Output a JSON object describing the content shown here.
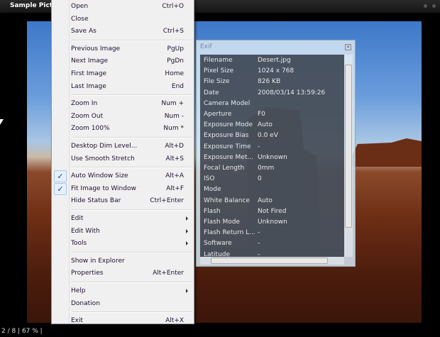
{
  "window": {
    "title": "Sample Pictu"
  },
  "status": {
    "text": "2 / 8 | 67 % |"
  },
  "menu": {
    "items": [
      {
        "label": "Open",
        "shortcut": "Ctrl+O"
      },
      {
        "label": "Close",
        "shortcut": ""
      },
      {
        "label": "Save As",
        "shortcut": "Ctrl+S"
      },
      {
        "sep": true
      },
      {
        "label": "Previous Image",
        "shortcut": "PgUp"
      },
      {
        "label": "Next Image",
        "shortcut": "PgDn"
      },
      {
        "label": "First Image",
        "shortcut": "Home"
      },
      {
        "label": "Last Image",
        "shortcut": "End"
      },
      {
        "sep": true
      },
      {
        "label": "Zoom In",
        "shortcut": "Num +"
      },
      {
        "label": "Zoom Out",
        "shortcut": "Num -"
      },
      {
        "label": "Zoom 100%",
        "shortcut": "Num *"
      },
      {
        "sep": true
      },
      {
        "label": "Desktop Dim Level...",
        "shortcut": "Alt+D"
      },
      {
        "label": "Use Smooth Stretch",
        "shortcut": "Alt+S"
      },
      {
        "sep": true
      },
      {
        "label": "Auto Window Size",
        "shortcut": "Alt+A",
        "checked": true
      },
      {
        "label": "Fit Image to Window",
        "shortcut": "Alt+F",
        "checked": true
      },
      {
        "label": "Hide Status Bar",
        "shortcut": "Ctrl+Enter"
      },
      {
        "sep": true
      },
      {
        "label": "Edit",
        "submenu": true
      },
      {
        "label": "Edit With",
        "submenu": true
      },
      {
        "label": "Tools",
        "submenu": true
      },
      {
        "sep": true
      },
      {
        "label": "Show in Explorer",
        "shortcut": ""
      },
      {
        "label": "Properties",
        "shortcut": "Alt+Enter"
      },
      {
        "sep": true
      },
      {
        "label": "Help",
        "submenu": true
      },
      {
        "label": "Donation",
        "shortcut": ""
      },
      {
        "sep": true
      },
      {
        "label": "Exit",
        "shortcut": "Alt+X"
      }
    ]
  },
  "exif": {
    "title": "Exif",
    "rows": [
      {
        "k": "Filename",
        "v": "Desert.jpg"
      },
      {
        "k": "Pixel Size",
        "v": "1024 x 768"
      },
      {
        "k": "File Size",
        "v": "826 KB"
      },
      {
        "k": "Date",
        "v": "2008/03/14 13:59:26"
      },
      {
        "k": "Camera Model",
        "v": ""
      },
      {
        "k": "Aperture",
        "v": "F0"
      },
      {
        "k": "Exposure Mode",
        "v": "Auto"
      },
      {
        "k": "Exposure Bias",
        "v": "0.0 eV"
      },
      {
        "k": "Exposure Time",
        "v": "-"
      },
      {
        "k": "Exposure Met...",
        "v": "Unknown"
      },
      {
        "k": "Focal Length",
        "v": "0mm"
      },
      {
        "k": "ISO",
        "v": "0"
      },
      {
        "k": "Mode",
        "v": ""
      },
      {
        "k": "White Balance",
        "v": "Auto"
      },
      {
        "k": "Flash",
        "v": "Not Fired"
      },
      {
        "k": "Flash Mode",
        "v": "Unknown"
      },
      {
        "k": "Flash Return L...",
        "v": "-"
      },
      {
        "k": "Software",
        "v": "-"
      },
      {
        "k": "Latitude",
        "v": "-"
      }
    ]
  }
}
